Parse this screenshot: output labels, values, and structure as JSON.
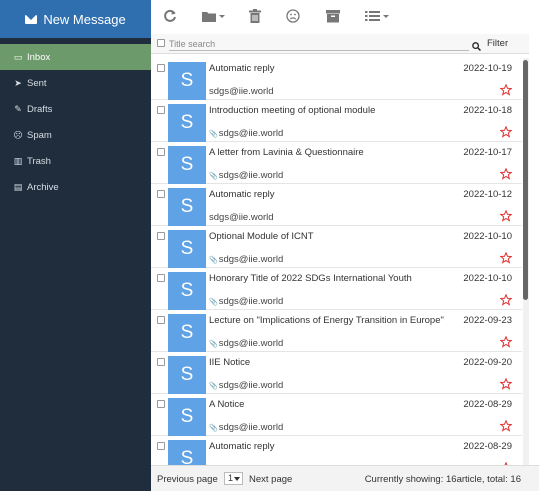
{
  "sidebar": {
    "new_message": "New Message",
    "items": [
      {
        "label": "Inbox",
        "icon": "inbox-icon",
        "glyph": "▭"
      },
      {
        "label": "Sent",
        "icon": "send-icon",
        "glyph": "➤"
      },
      {
        "label": "Drafts",
        "icon": "edit-icon",
        "glyph": "✎"
      },
      {
        "label": "Spam",
        "icon": "frown-icon",
        "glyph": "☹"
      },
      {
        "label": "Trash",
        "icon": "trash-icon",
        "glyph": "▥"
      },
      {
        "label": "Archive",
        "icon": "archive-icon",
        "glyph": "▤"
      }
    ],
    "active_index": 0
  },
  "toolbar": {
    "buttons": [
      "refresh-icon",
      "folder-move-icon",
      "trash-icon",
      "spam-icon",
      "archive-icon",
      "list-view-icon"
    ]
  },
  "search": {
    "placeholder": "Title search",
    "filter_label": "Filter"
  },
  "messages": [
    {
      "avatar": "S",
      "subject": "Automatic reply",
      "date": "2022-10-19",
      "from": "sdgs@iie.world",
      "attachment": false
    },
    {
      "avatar": "S",
      "subject": "Introduction meeting of optional module",
      "date": "2022-10-18",
      "from": "sdgs@iie.world",
      "attachment": true
    },
    {
      "avatar": "S",
      "subject": "A letter from Lavinia & Questionnaire",
      "date": "2022-10-17",
      "from": "sdgs@iie.world",
      "attachment": true
    },
    {
      "avatar": "S",
      "subject": "Automatic reply",
      "date": "2022-10-12",
      "from": "sdgs@iie.world",
      "attachment": false
    },
    {
      "avatar": "S",
      "subject": "Optional Module of ICNT",
      "date": "2022-10-10",
      "from": "sdgs@iie.world",
      "attachment": true
    },
    {
      "avatar": "S",
      "subject": "Honorary Title of 2022 SDGs International Youth",
      "date": "2022-10-10",
      "from": "sdgs@iie.world",
      "attachment": true
    },
    {
      "avatar": "S",
      "subject": "Lecture on \"Implications of Energy Transition in Europe\"",
      "date": "2022-09-23",
      "from": "sdgs@iie.world",
      "attachment": true
    },
    {
      "avatar": "S",
      "subject": "IIE Notice",
      "date": "2022-09-20",
      "from": "sdgs@iie.world",
      "attachment": true
    },
    {
      "avatar": "S",
      "subject": "A Notice",
      "date": "2022-08-29",
      "from": "sdgs@iie.world",
      "attachment": true
    },
    {
      "avatar": "S",
      "subject": "Automatic reply",
      "date": "2022-08-29",
      "from": "",
      "attachment": false
    }
  ],
  "footer": {
    "prev_label": "Previous page",
    "page_value": "1",
    "next_label": "Next page",
    "showing_text": "Currently showing: 16article,  total:  16"
  },
  "colors": {
    "sidebar_bg": "#1f2d3d",
    "new_message_bg": "#2f6fb0",
    "active_item_bg": "#6c9a6a",
    "avatar_bg": "#5fa3e6",
    "star": "#e03030"
  }
}
